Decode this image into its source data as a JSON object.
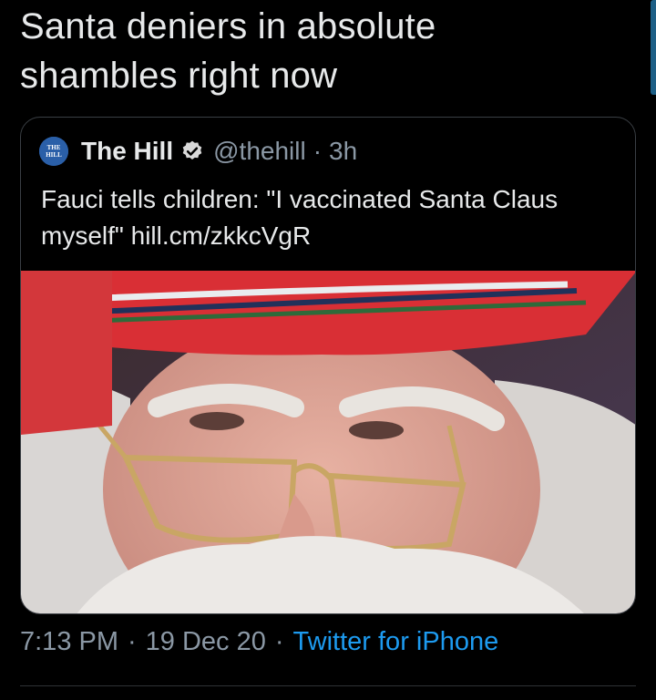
{
  "tweet": {
    "text": "Santa deniers in absolute\nshambles right now",
    "time": "7:13 PM",
    "date": "19 Dec 20",
    "source": "Twitter for iPhone"
  },
  "quoted": {
    "author_name": "The Hill",
    "avatar_text": "THE HILL",
    "handle": "@thehill",
    "age": "3h",
    "body": "Fauci tells children: \"I vaccinated Santa Claus myself\" hill.cm/zkkcVgR",
    "image_subject": "Santa Claus close-up wearing red knit hat and gold reading glasses"
  },
  "colors": {
    "background": "#000000",
    "link": "#1d9bf0",
    "muted": "#8b98a5",
    "verified": "#d9d9d9"
  }
}
